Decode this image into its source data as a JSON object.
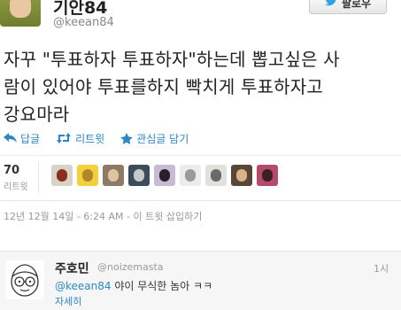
{
  "header": {
    "display_name": "기안84",
    "screen_name": "@keean84",
    "follow_label": "팔로우"
  },
  "tweet": {
    "lines": [
      "자꾸 \"투표하자 투표하자\"하는데 뽑고싶은 사",
      "람이 있어야 투표를하지 빡치게 투표하자고",
      "강요마라"
    ]
  },
  "actions": {
    "reply": "답글",
    "retweet": "리트윗",
    "favorite": "관심글 담기"
  },
  "stats": {
    "retweet_count": "70",
    "retweet_label": "리트윗"
  },
  "timestamp": "12년 12월 14일 - 6:24 AM - 이 트윗 삽입하기",
  "reply": {
    "name": "주호민",
    "handle": "@noizemasta",
    "time": "1시",
    "mention": "@keean84",
    "text": " 야이 무식한 놈아 ㅋㅋ",
    "detail": "자세히"
  },
  "colors": {
    "link": "#2f86c4",
    "twitter_bird": "#2ea2df"
  }
}
